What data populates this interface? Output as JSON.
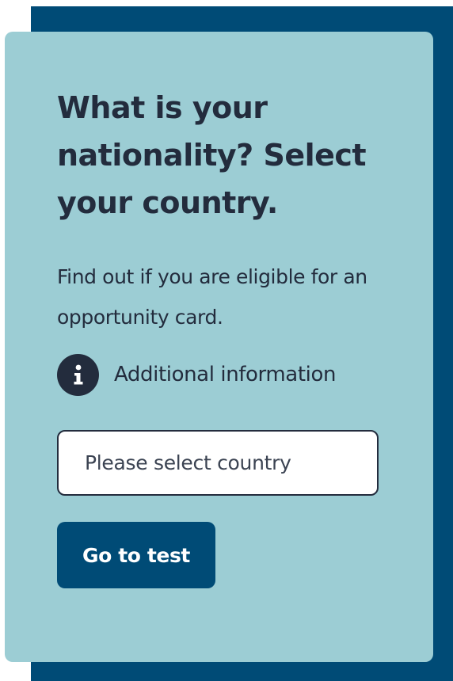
{
  "card": {
    "heading": "What is your nationality? Select your country.",
    "intro": "Find out if you are eligible for an opportunity card.",
    "info": {
      "icon": "info-icon",
      "label": "Additional information"
    },
    "country_select": {
      "placeholder": "Please select country"
    },
    "submit_label": "Go to test"
  },
  "colors": {
    "card_background": "#9ccdd4",
    "accent_dark_blue": "#004b76",
    "text_dark": "#232c3d",
    "input_background": "#ffffff"
  }
}
